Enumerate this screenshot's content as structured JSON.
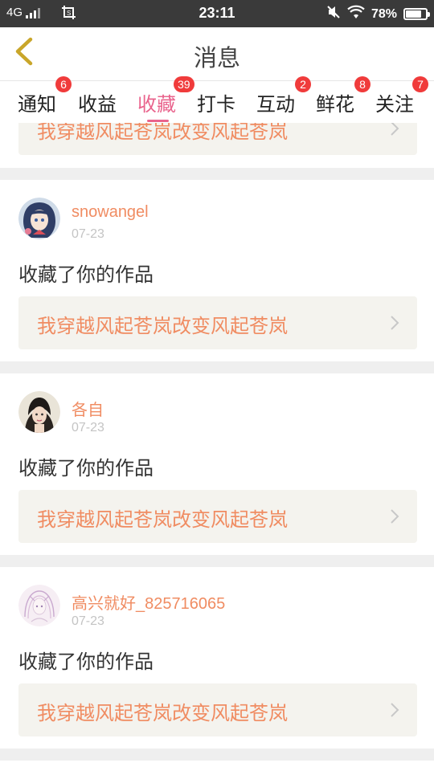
{
  "status_bar": {
    "network": "4G",
    "time": "23:11",
    "battery_percent": "78%",
    "battery_level": 0.78
  },
  "header": {
    "title": "消息"
  },
  "tabs": [
    {
      "label": "通知",
      "badge": "6"
    },
    {
      "label": "收益",
      "badge": ""
    },
    {
      "label": "收藏",
      "badge": "39",
      "active": true
    },
    {
      "label": "打卡",
      "badge": ""
    },
    {
      "label": "互动",
      "badge": "2"
    },
    {
      "label": "鲜花",
      "badge": "8"
    },
    {
      "label": "关注",
      "badge": "7"
    }
  ],
  "feed": {
    "partial_work_title": "我穿越风起苍岚改变风起苍岚",
    "items": [
      {
        "username": "snowangel",
        "date": "07-23",
        "action": "收藏了你的作品",
        "work_title": "我穿越风起苍岚改变风起苍岚"
      },
      {
        "username": "各自",
        "date": "07-23",
        "action": "收藏了你的作品",
        "work_title": "我穿越风起苍岚改变风起苍岚"
      },
      {
        "username": "高兴就好_825716065",
        "date": "07-23",
        "action": "收藏了你的作品",
        "work_title": "我穿越风起苍岚改变风起苍岚"
      }
    ]
  },
  "colors": {
    "accent_pink": "#e9648d",
    "username_orange": "#f08c62",
    "badge_red": "#f03b3b",
    "back_yellow": "#c9a62a"
  },
  "icons": {
    "back": "chevron-left-icon",
    "work_arrow": "chevron-right-icon"
  }
}
